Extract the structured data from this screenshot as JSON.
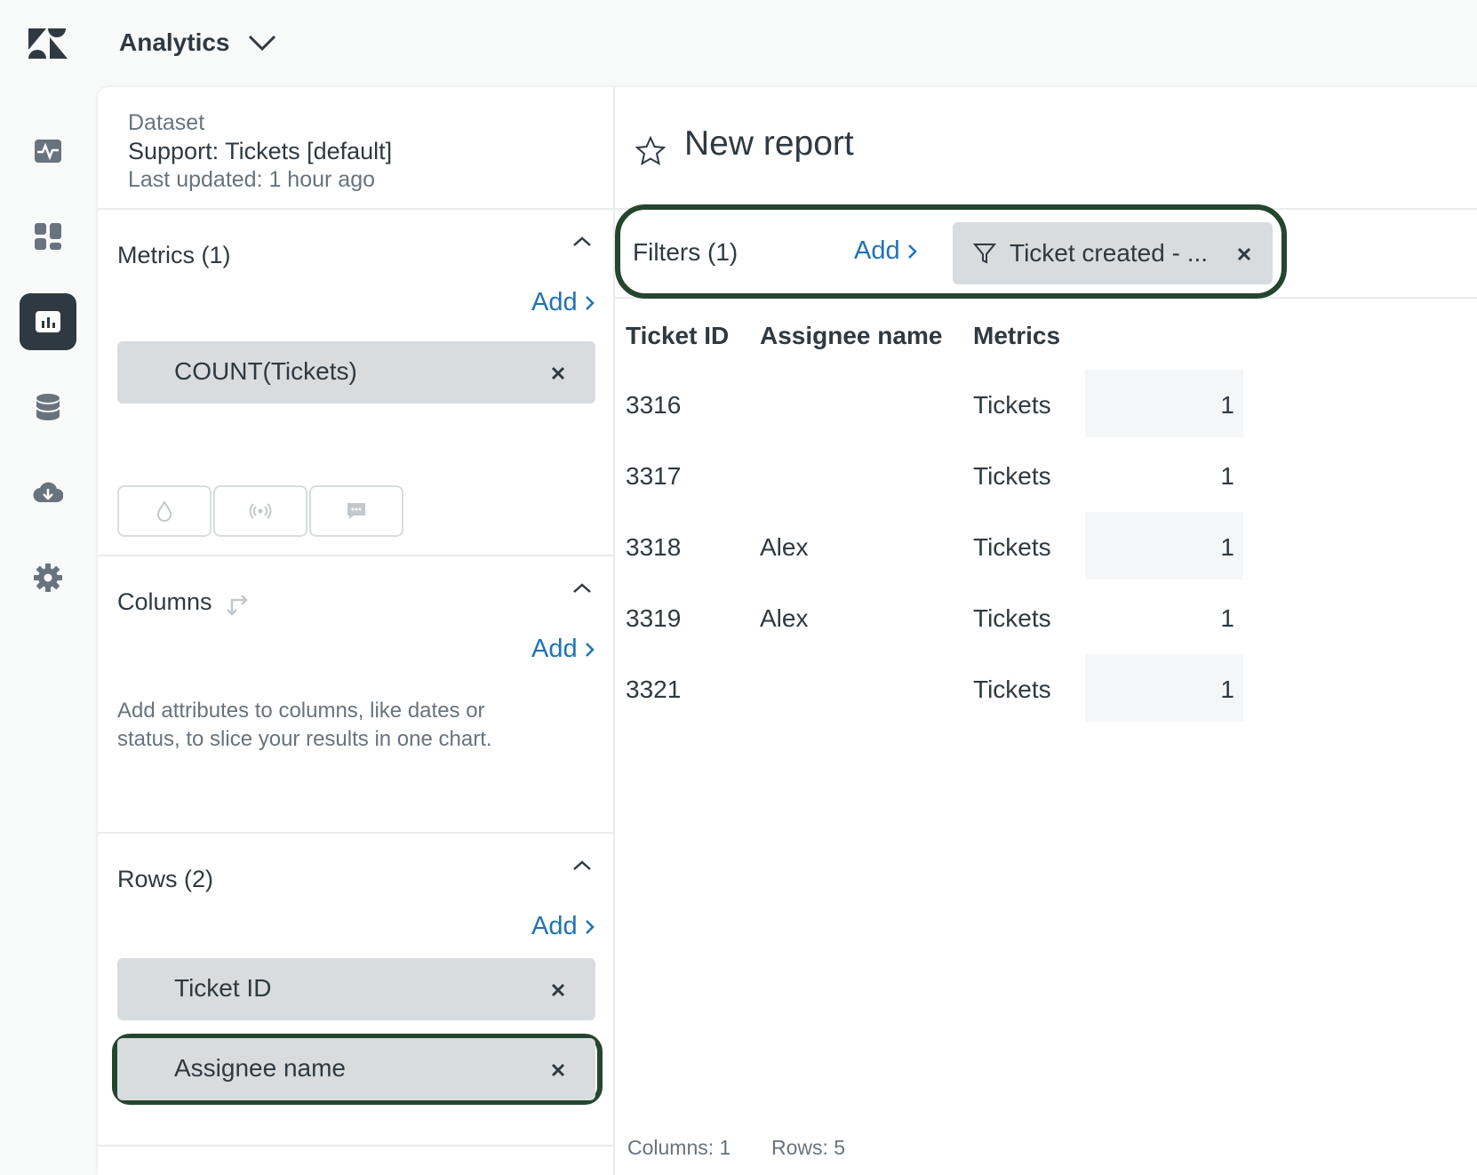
{
  "app": {
    "title": "Analytics"
  },
  "nav": [
    "dashboard-icon",
    "grid-icon",
    "reports-icon",
    "database-icon",
    "cloud-download-icon",
    "settings-icon"
  ],
  "dataset": {
    "label": "Dataset",
    "name": "Support: Tickets [default]",
    "updated": "Last updated: 1 hour ago"
  },
  "metrics": {
    "title": "Metrics (1)",
    "add": "Add",
    "items": [
      "COUNT(Tickets)"
    ]
  },
  "columns": {
    "title": "Columns",
    "add": "Add",
    "help": "Add attributes to columns, like dates or status, to slice your results in one chart."
  },
  "rows": {
    "title": "Rows (2)",
    "add": "Add",
    "items": [
      "Ticket ID",
      "Assignee name"
    ]
  },
  "report": {
    "title": "New report",
    "filters_label": "Filters (1)",
    "filters_add": "Add",
    "filter_chip": "Ticket created - ..."
  },
  "table": {
    "headers": [
      "Ticket ID",
      "Assignee name",
      "Metrics"
    ],
    "rows": [
      {
        "id": "3316",
        "assignee": "",
        "metric": "Tickets",
        "value": "1"
      },
      {
        "id": "3317",
        "assignee": "",
        "metric": "Tickets",
        "value": "1"
      },
      {
        "id": "3318",
        "assignee": "Alex",
        "metric": "Tickets",
        "value": "1"
      },
      {
        "id": "3319",
        "assignee": "Alex",
        "metric": "Tickets",
        "value": "1"
      },
      {
        "id": "3321",
        "assignee": "",
        "metric": "Tickets",
        "value": "1"
      }
    ]
  },
  "footer": {
    "columns": "Columns: 1",
    "rows": "Rows: 5"
  },
  "colors": {
    "link": "#1f73b7",
    "highlight": "#24452e",
    "chip": "#d8dcde"
  }
}
